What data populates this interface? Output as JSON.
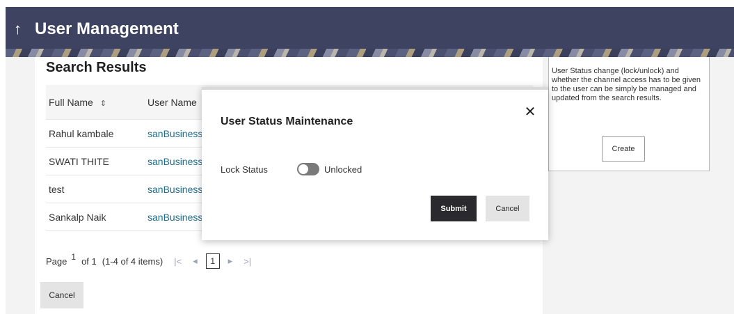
{
  "header": {
    "back_icon": "up-arrow-icon",
    "title": "User Management"
  },
  "search_results": {
    "title": "Search Results",
    "columns": {
      "full_name": "Full Name",
      "sort_icon": "sort-icon",
      "user_name": "User Name"
    },
    "rows": [
      {
        "full_name": "Rahul kambale",
        "user_name": "sanBusiness"
      },
      {
        "full_name": "SWATI THITE",
        "user_name": "sanBusiness"
      },
      {
        "full_name": "test",
        "user_name": "sanBusiness"
      },
      {
        "full_name": "Sankalp Naik",
        "user_name": "sanBusiness"
      }
    ],
    "pagination": {
      "page_label": "Page",
      "page_number": "1",
      "of_label": "of 1",
      "items_label": "(1-4 of 4 items)",
      "first": "|<",
      "prev": "◂",
      "current": "1",
      "next": "▸",
      "last": ">|"
    },
    "cancel_label": "Cancel"
  },
  "info_panel": {
    "text": "User Status change (lock/unlock) and whether the channel access has to be given to the user can be simply be managed and updated from the search results.",
    "create_label": "Create"
  },
  "modal": {
    "title": "User Status Maintenance",
    "close_icon": "close-icon",
    "lock_label": "Lock Status",
    "lock_value": "Unlocked",
    "submit_label": "Submit",
    "cancel_label": "Cancel"
  }
}
